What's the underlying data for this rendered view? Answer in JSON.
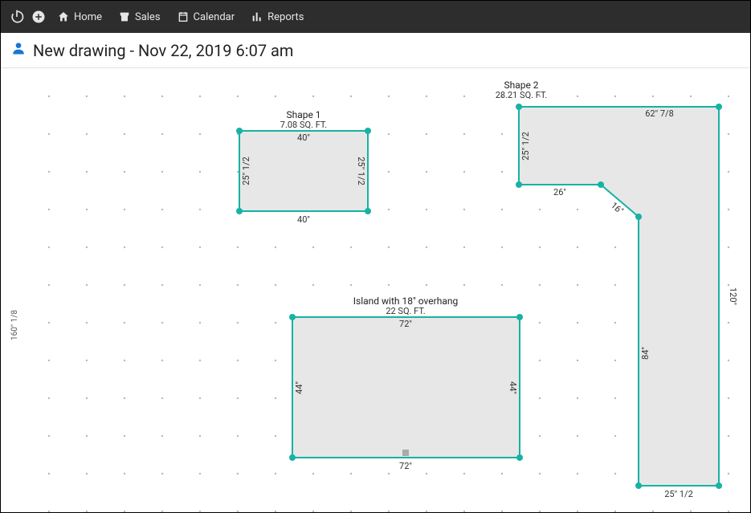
{
  "nav": {
    "home": "Home",
    "sales": "Sales",
    "calendar": "Calendar",
    "reports": "Reports"
  },
  "title": "New drawing - Nov 22, 2019 6:07 am",
  "ruler_left": "160\" 1/8",
  "shapes": {
    "shape1": {
      "label": "Shape 1",
      "area": "7.08 SQ. FT.",
      "dims": {
        "top": "40\"",
        "bottom": "40\"",
        "left": "25\" 1/2",
        "right": "25\" 1/2"
      }
    },
    "island": {
      "label": "Island with 18\" overhang",
      "area": "22 SQ. FT.",
      "dims": {
        "top": "72\"",
        "bottom": "72\"",
        "left": "44\"",
        "right": "44\""
      }
    },
    "shape2": {
      "label": "Shape 2",
      "area": "28.21 SQ. FT.",
      "dims": {
        "top": "62\" 7/8",
        "left": "25\" 1/2",
        "seg_bottom_left": "26\"",
        "diag": "16\"",
        "inner_right": "84\"",
        "outer_right": "120\"",
        "bottom": "25\" 1/2"
      }
    }
  }
}
